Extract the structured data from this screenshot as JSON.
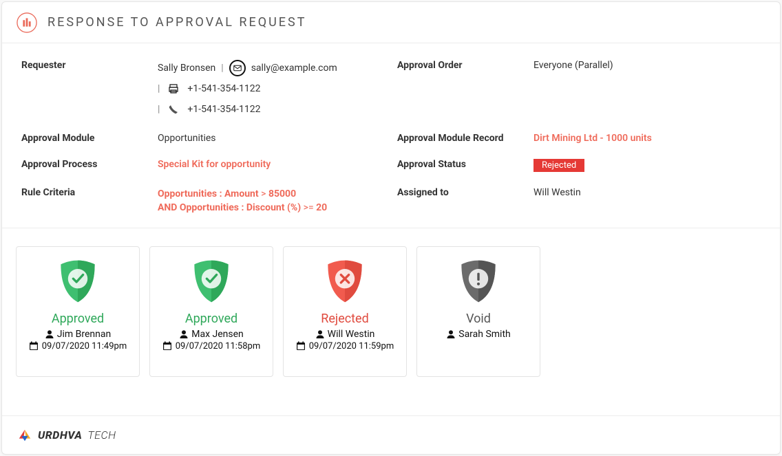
{
  "header": {
    "title": "RESPONSE TO APPROVAL REQUEST"
  },
  "labels": {
    "requester": "Requester",
    "approval_order": "Approval Order",
    "approval_module": "Approval Module",
    "approval_module_record": "Approval Module Record",
    "approval_process": "Approval Process",
    "approval_status": "Approval Status",
    "rule_criteria": "Rule Criteria",
    "assigned_to": "Assigned to"
  },
  "requester": {
    "name": "Sally Bronsen",
    "email": "sally@example.com",
    "fax": "+1-541-354-1122",
    "phone": "+1-541-354-1122"
  },
  "approval_order": "Everyone (Parallel)",
  "approval_module": "Opportunities",
  "approval_module_record": "Dirt Mining Ltd - 1000 units",
  "approval_process": "Special Kit for opportunity",
  "approval_status": "Rejected",
  "assigned_to": "Will Westin",
  "rule": {
    "l1a": "Opportunities : Amount",
    "l1op": ">",
    "l1v": "85000",
    "and": "AND",
    "l2a": "Opportunities : Discount (%)",
    "l2op": ">=",
    "l2v": "20"
  },
  "approvers": [
    {
      "status": "Approved",
      "css": "st-approved",
      "shield": "approved",
      "name": "Jim Brennan",
      "date": "09/07/2020 11:49pm"
    },
    {
      "status": "Approved",
      "css": "st-approved",
      "shield": "approved",
      "name": "Max Jensen",
      "date": "09/07/2020 11:58pm"
    },
    {
      "status": "Rejected",
      "css": "st-rejected",
      "shield": "rejected",
      "name": "Will Westin",
      "date": "09/07/2020 11:59pm"
    },
    {
      "status": "Void",
      "css": "st-void",
      "shield": "void",
      "name": "Sarah Smith",
      "date": ""
    }
  ],
  "footer": {
    "brand1": "URDHVA",
    "brand2": " TECH"
  }
}
